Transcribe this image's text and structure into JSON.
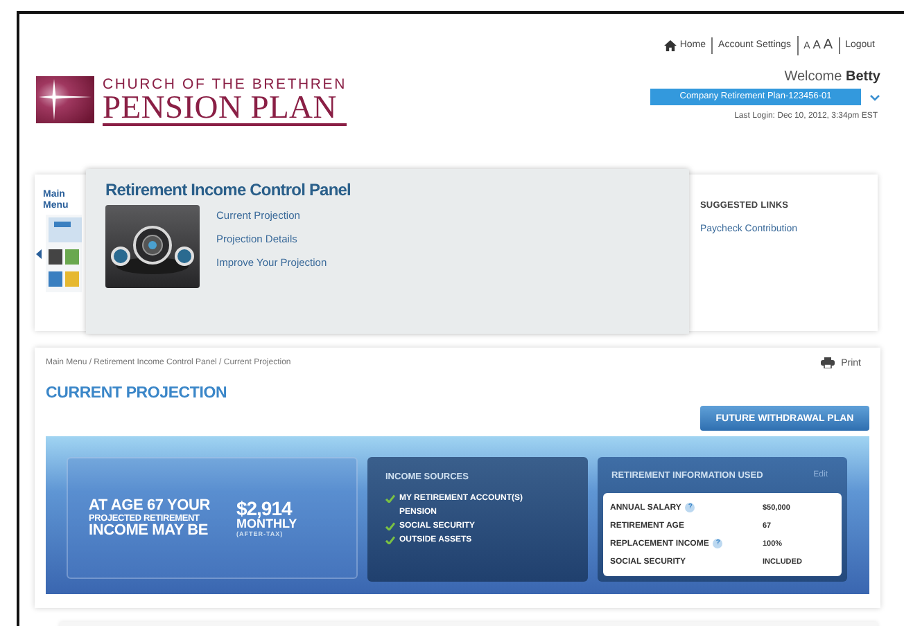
{
  "top_nav": [
    {
      "kind": "home",
      "label": "Home"
    },
    {
      "kind": "link",
      "label": "Account Settings"
    },
    {
      "kind": "text_size",
      "label": "AAA"
    },
    {
      "kind": "link",
      "label": "Logout"
    }
  ],
  "logo": {
    "line_1": "CHURCH OF THE BRETHREN",
    "line_2": "PENSION PLAN"
  },
  "welcome": {
    "greeting": "Welcome",
    "name": "Betty"
  },
  "plan_select": {
    "value": "Company Retirement Plan-123456-01"
  },
  "last_login": "Last Login: Dec 10, 2012, 3:34pm EST",
  "main_menu": {
    "label": "Main Menu"
  },
  "control_panel": {
    "title": "Retirement Income Control Panel",
    "links": [
      "Current Projection",
      "Projection Details",
      "Improve Your Projection"
    ]
  },
  "suggested_links": {
    "title": "SUGGESTED LINKS",
    "links": [
      "Paycheck Contribution"
    ]
  },
  "breadcrumb": "Main Menu / Retirement Income Control Panel / Current Projection",
  "print": "Print",
  "page_title": "CURRENT PROJECTION",
  "action_button": "FUTURE WITHDRAWAL PLAN",
  "projection": {
    "headline_1": "AT AGE 67 YOUR",
    "headline_2": "PROJECTED RETIREMENT",
    "headline_3": "INCOME MAY BE",
    "amount": "$2,914",
    "period": "MONTHLY",
    "note": "(AFTER-TAX)"
  },
  "income_sources": {
    "title": "INCOME SOURCES",
    "items": [
      {
        "label": "MY RETIREMENT ACCOUNT(S)",
        "checked": true
      },
      {
        "label": "PENSION",
        "checked": false
      },
      {
        "label": "SOCIAL SECURITY",
        "checked": true
      },
      {
        "label": "OUTSIDE ASSETS",
        "checked": true
      }
    ]
  },
  "retirement_info": {
    "title": "RETIREMENT INFORMATION USED",
    "edit": "Edit",
    "rows": [
      {
        "label": "ANNUAL SALARY",
        "help": "?",
        "value": "$50,000"
      },
      {
        "label": "RETIREMENT AGE",
        "value": "67"
      },
      {
        "label": "REPLACEMENT INCOME",
        "help": "?",
        "value": "100%"
      },
      {
        "label": "SOCIAL SECURITY",
        "value": "INCLUDED"
      }
    ]
  }
}
